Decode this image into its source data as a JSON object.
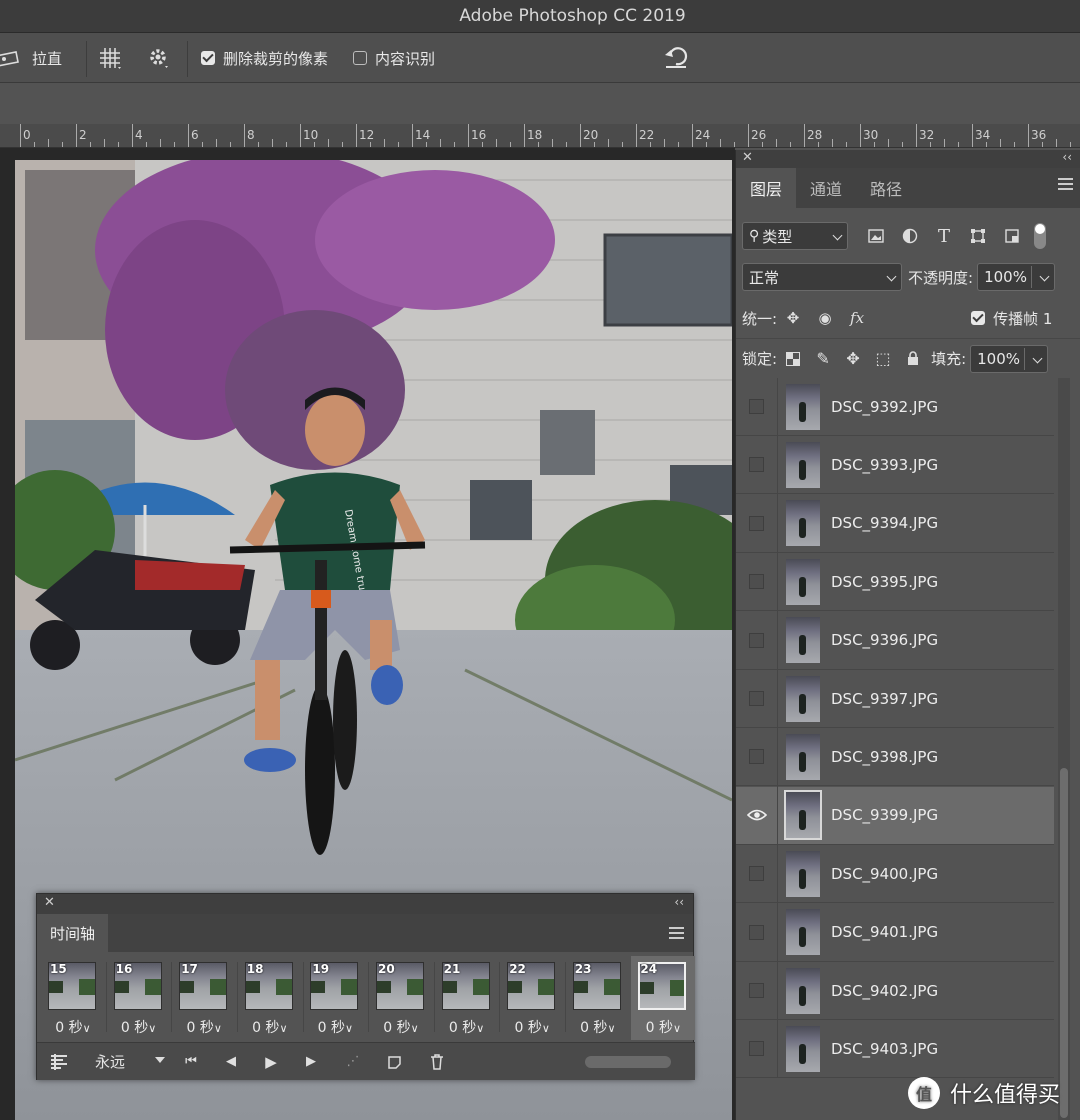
{
  "app": {
    "title": "Adobe Photoshop CC 2019"
  },
  "options_bar": {
    "straighten_label": "拉直",
    "delete_cropped_label": "删除裁剪的像素",
    "delete_cropped_checked": true,
    "content_aware_label": "内容识别",
    "content_aware_checked": false
  },
  "ruler": {
    "labels": [
      "0",
      "2",
      "4",
      "6",
      "8",
      "10",
      "12",
      "14",
      "16",
      "18",
      "20",
      "22",
      "24",
      "26",
      "28",
      "30",
      "32",
      "34",
      "36"
    ]
  },
  "layers_panel": {
    "tabs": [
      "图层",
      "通道",
      "路径"
    ],
    "active_tab": "图层",
    "filter_label": "类型",
    "blend_mode": "正常",
    "opacity_label": "不透明度:",
    "opacity_value": "100%",
    "unify_label": "统一:",
    "propagate_label": "传播帧 1",
    "propagate_checked": true,
    "lock_label": "锁定:",
    "fill_label": "填充:",
    "fill_value": "100%",
    "layers": [
      {
        "name": "DSC_9392.JPG",
        "visible": false,
        "selected": false
      },
      {
        "name": "DSC_9393.JPG",
        "visible": false,
        "selected": false
      },
      {
        "name": "DSC_9394.JPG",
        "visible": false,
        "selected": false
      },
      {
        "name": "DSC_9395.JPG",
        "visible": false,
        "selected": false
      },
      {
        "name": "DSC_9396.JPG",
        "visible": false,
        "selected": false
      },
      {
        "name": "DSC_9397.JPG",
        "visible": false,
        "selected": false
      },
      {
        "name": "DSC_9398.JPG",
        "visible": false,
        "selected": false
      },
      {
        "name": "DSC_9399.JPG",
        "visible": true,
        "selected": true
      },
      {
        "name": "DSC_9400.JPG",
        "visible": false,
        "selected": false
      },
      {
        "name": "DSC_9401.JPG",
        "visible": false,
        "selected": false
      },
      {
        "name": "DSC_9402.JPG",
        "visible": false,
        "selected": false
      },
      {
        "name": "DSC_9403.JPG",
        "visible": false,
        "selected": false
      }
    ]
  },
  "timeline": {
    "tab_label": "时间轴",
    "loop_label": "永远",
    "frames": [
      {
        "number": "15",
        "delay": "0 秒",
        "selected": false
      },
      {
        "number": "16",
        "delay": "0 秒",
        "selected": false
      },
      {
        "number": "17",
        "delay": "0 秒",
        "selected": false
      },
      {
        "number": "18",
        "delay": "0 秒",
        "selected": false
      },
      {
        "number": "19",
        "delay": "0 秒",
        "selected": false
      },
      {
        "number": "20",
        "delay": "0 秒",
        "selected": false
      },
      {
        "number": "21",
        "delay": "0 秒",
        "selected": false
      },
      {
        "number": "22",
        "delay": "0 秒",
        "selected": false
      },
      {
        "number": "23",
        "delay": "0 秒",
        "selected": false
      },
      {
        "number": "24",
        "delay": "0 秒",
        "selected": true
      }
    ]
  },
  "photo": {
    "shirt_text": "Dream come true"
  },
  "watermark": {
    "logo_glyph": "值",
    "text": "什么值得买"
  },
  "colors": {
    "panel_bg": "#535353",
    "selected_layer": "#6b6b6b",
    "title_bar": "#3c3c3c"
  }
}
